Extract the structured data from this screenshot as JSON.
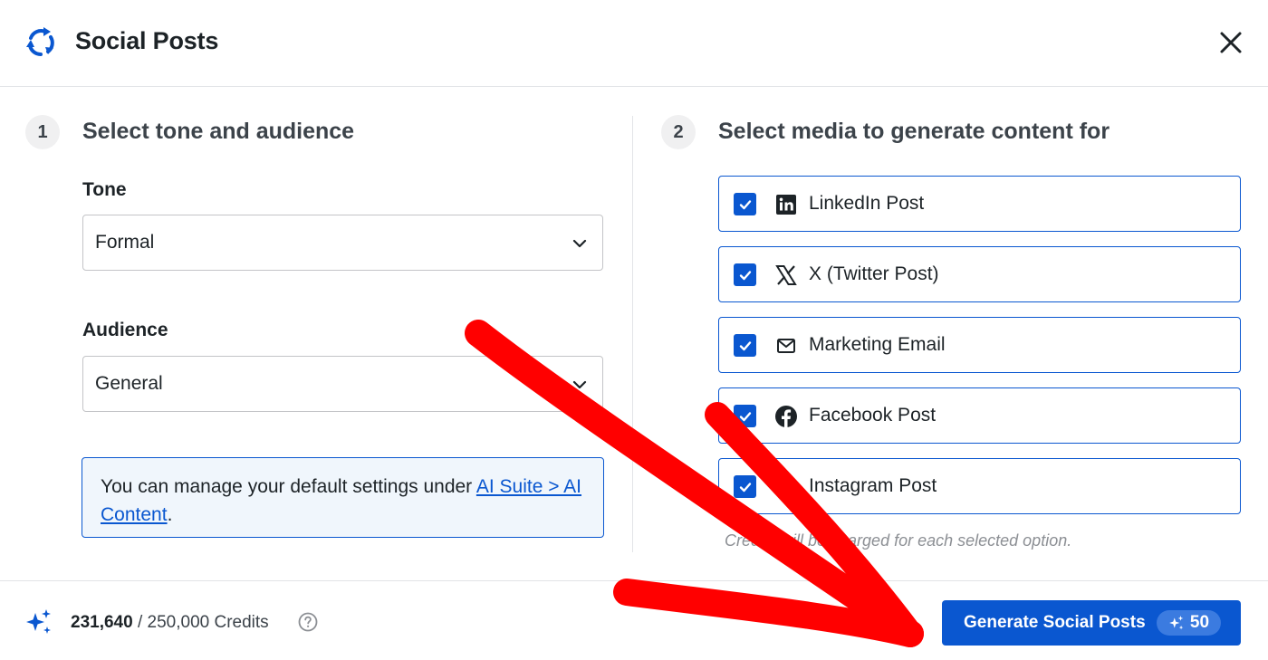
{
  "header": {
    "title": "Social Posts",
    "logo_icon": "circular-arrows-icon",
    "close_icon": "close-icon"
  },
  "step1": {
    "number": "1",
    "title": "Select tone and audience",
    "tone": {
      "label": "Tone",
      "value": "Formal"
    },
    "audience": {
      "label": "Audience",
      "value": "General"
    },
    "notice": {
      "text": "You can manage your default settings under ",
      "link": "AI Suite > AI Content",
      "suffix": "."
    }
  },
  "step2": {
    "number": "2",
    "title": "Select media to generate content for",
    "options": [
      {
        "label": "LinkedIn Post",
        "icon": "linkedin-icon",
        "checked": true
      },
      {
        "label": "X (Twitter Post)",
        "icon": "x-twitter-icon",
        "checked": true
      },
      {
        "label": "Marketing Email",
        "icon": "mail-icon",
        "checked": true
      },
      {
        "label": "Facebook Post",
        "icon": "facebook-icon",
        "checked": true
      },
      {
        "label": "Instagram Post",
        "icon": "instagram-icon",
        "checked": true
      }
    ],
    "credit_note": "Credits will be charged for each selected option."
  },
  "footer": {
    "credits_used": "231,640",
    "credits_separator": " / ",
    "credits_total": "250,000 Credits",
    "generate_label": "Generate Social Posts",
    "generate_cost": "50"
  },
  "colors": {
    "accent": "#0a57d0",
    "annotation": "#ff0000",
    "notice_bg": "#f0f6fc"
  }
}
